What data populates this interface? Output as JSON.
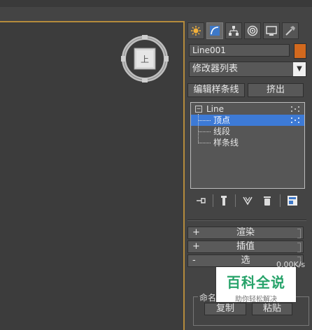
{
  "object_name": "Line001",
  "object_color": "#d2691e",
  "command_tabs": [
    {
      "icon": "sun-create-icon",
      "active": false
    },
    {
      "icon": "modify-curve-icon",
      "active": true
    },
    {
      "icon": "hierarchy-icon",
      "active": false
    },
    {
      "icon": "motion-icon",
      "active": false
    },
    {
      "icon": "display-monitor-icon",
      "active": false
    },
    {
      "icon": "utilities-hammer-icon",
      "active": false
    }
  ],
  "viewcube_label": "上",
  "modifier_list": {
    "label": "修改器列表"
  },
  "buttons": {
    "edit_spline": "编辑样条线",
    "collapse": "挤出"
  },
  "modifier_stack": {
    "root": "Line",
    "items": [
      {
        "label": "顶点",
        "selected": true
      },
      {
        "label": "线段",
        "selected": false
      },
      {
        "label": "样条线",
        "selected": false
      }
    ]
  },
  "stack_tools": [
    "pin-stack-icon",
    "show-end-result-icon",
    "make-unique-icon",
    "remove-modifier-icon",
    "configure-sets-icon"
  ],
  "rollouts": [
    {
      "sign": "+",
      "label": "渲染"
    },
    {
      "sign": "+",
      "label": "插值"
    },
    {
      "sign": "-",
      "label": "选"
    }
  ],
  "selection_group": {
    "label": "命名",
    "copy": "复制",
    "paste": "粘贴"
  },
  "net_speed": "0.00K/s",
  "watermark": {
    "title": "百科全说",
    "subtitle": "助你轻松解决"
  }
}
